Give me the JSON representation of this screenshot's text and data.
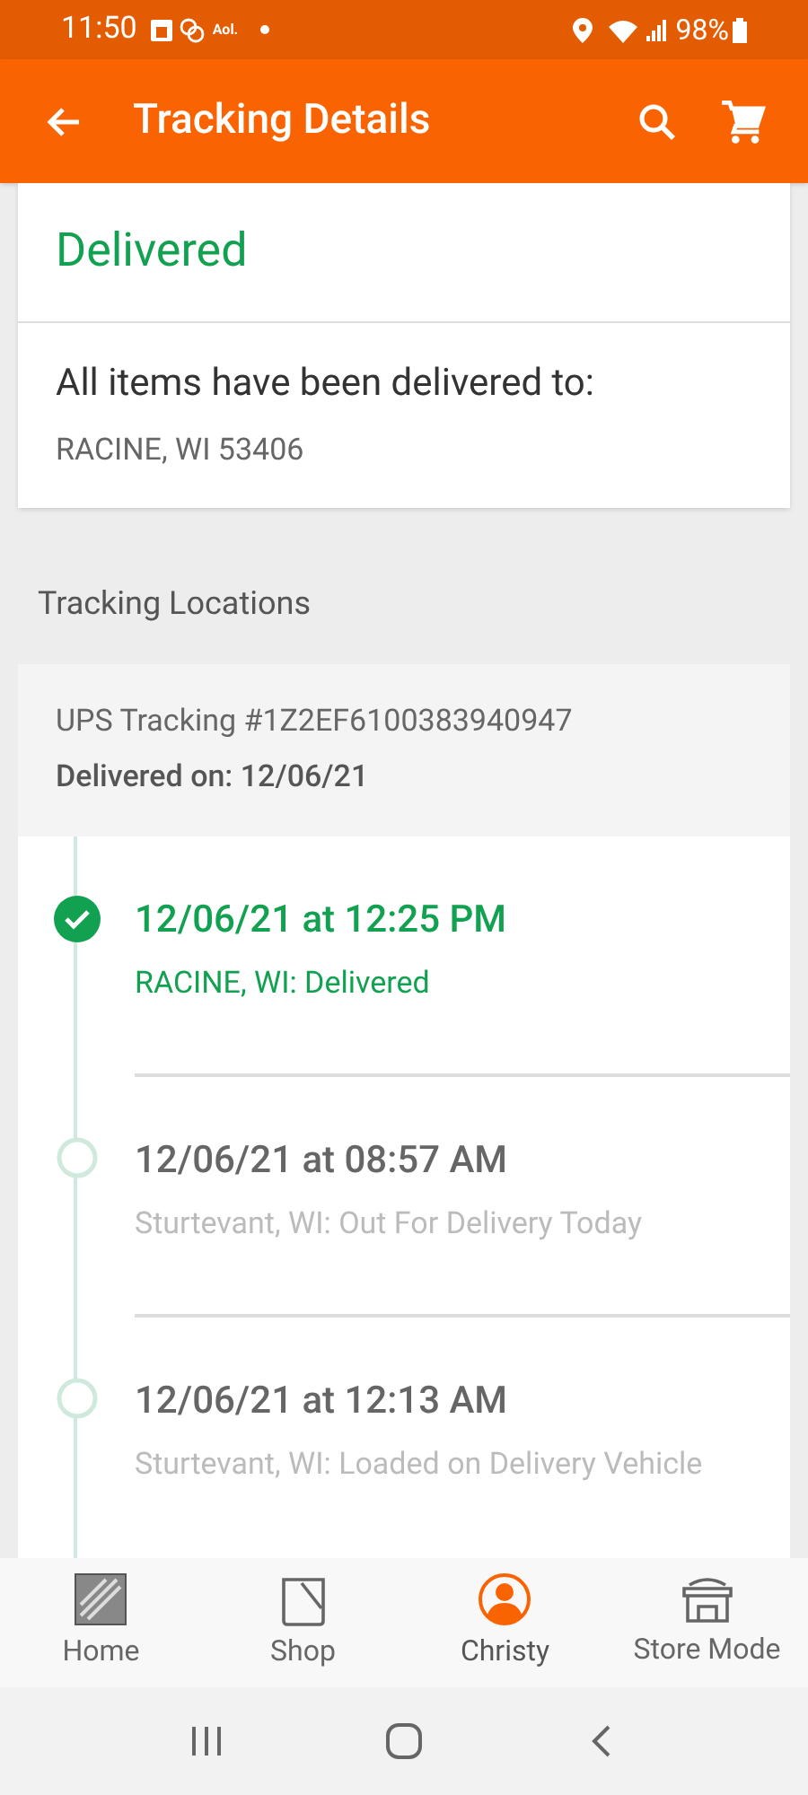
{
  "status_bar": {
    "time": "11:50",
    "carrier": "Aol.",
    "battery": "98%"
  },
  "app_bar": {
    "title": "Tracking Details"
  },
  "status_card": {
    "status": "Delivered",
    "message": "All items have been delivered to:",
    "address": "RACINE, WI 53406"
  },
  "section_title": "Tracking Locations",
  "shipment": {
    "tracking": "UPS Tracking #1Z2EF6100383940947",
    "delivered_on": "Delivered on: 12/06/21",
    "events": [
      {
        "time": "12/06/21 at 12:25 PM",
        "detail": "RACINE, WI: Delivered",
        "done": true
      },
      {
        "time": "12/06/21 at 08:57 AM",
        "detail": "Sturtevant, WI: Out For Delivery Today",
        "done": false
      },
      {
        "time": "12/06/21 at 12:13 AM",
        "detail": "Sturtevant, WI: Loaded on Delivery Vehicle",
        "done": false
      }
    ]
  },
  "bottom_nav": [
    {
      "label": "Home",
      "selected": false
    },
    {
      "label": "Shop",
      "selected": false
    },
    {
      "label": "Christy",
      "selected": true
    },
    {
      "label": "Store Mode",
      "selected": false
    }
  ]
}
